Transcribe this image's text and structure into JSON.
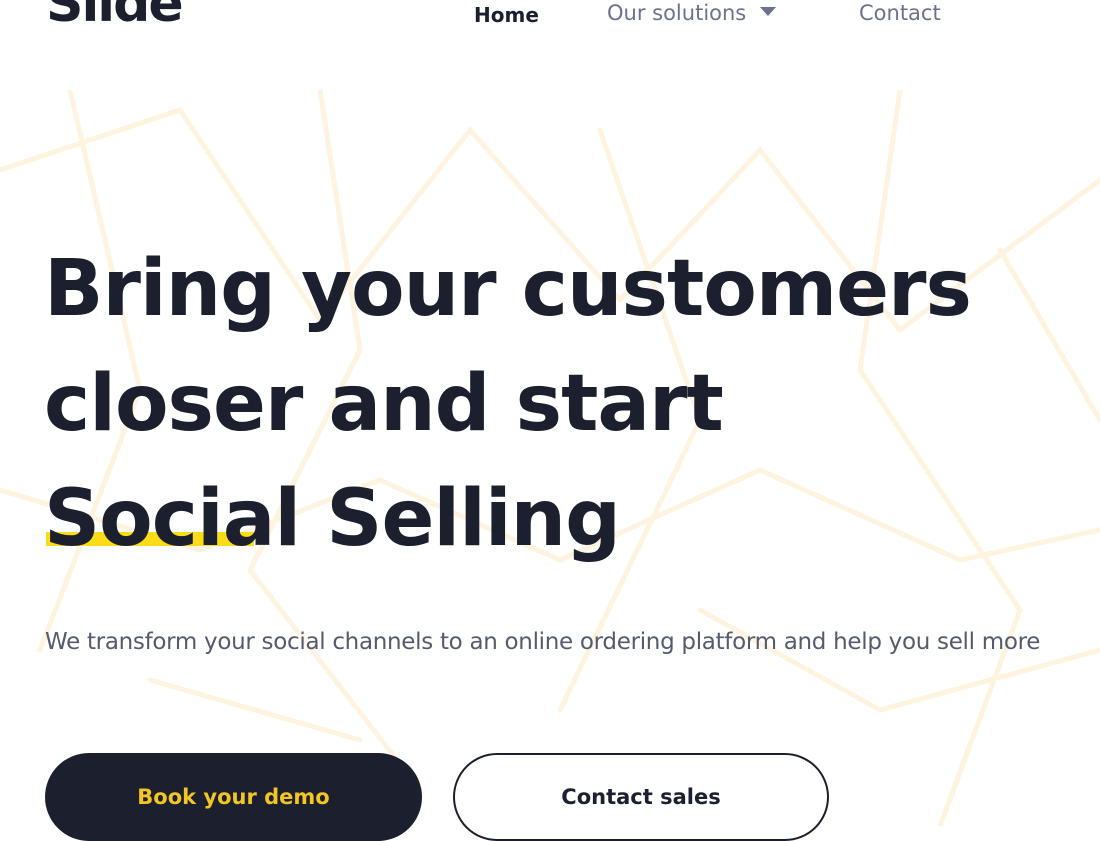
{
  "brand": {
    "logo_text": "Slide"
  },
  "nav": {
    "items": [
      {
        "label": "Home"
      },
      {
        "label": "Our solutions"
      },
      {
        "label": "Contact"
      }
    ]
  },
  "hero": {
    "title_line1": "Bring your customers",
    "title_line2": "closer and start",
    "title_line3_highlight": "Social",
    "title_line3_rest": " Selling",
    "subtitle": "We transform your social channels to an online ordering platform and help you sell more",
    "primary_button": "Book your demo",
    "secondary_button": "Contact sales"
  },
  "colors": {
    "primary_dark": "#1c1f2e",
    "accent_yellow": "#fbdc19",
    "nav_muted": "#6d7190",
    "background_lines": "#fdf3df"
  }
}
